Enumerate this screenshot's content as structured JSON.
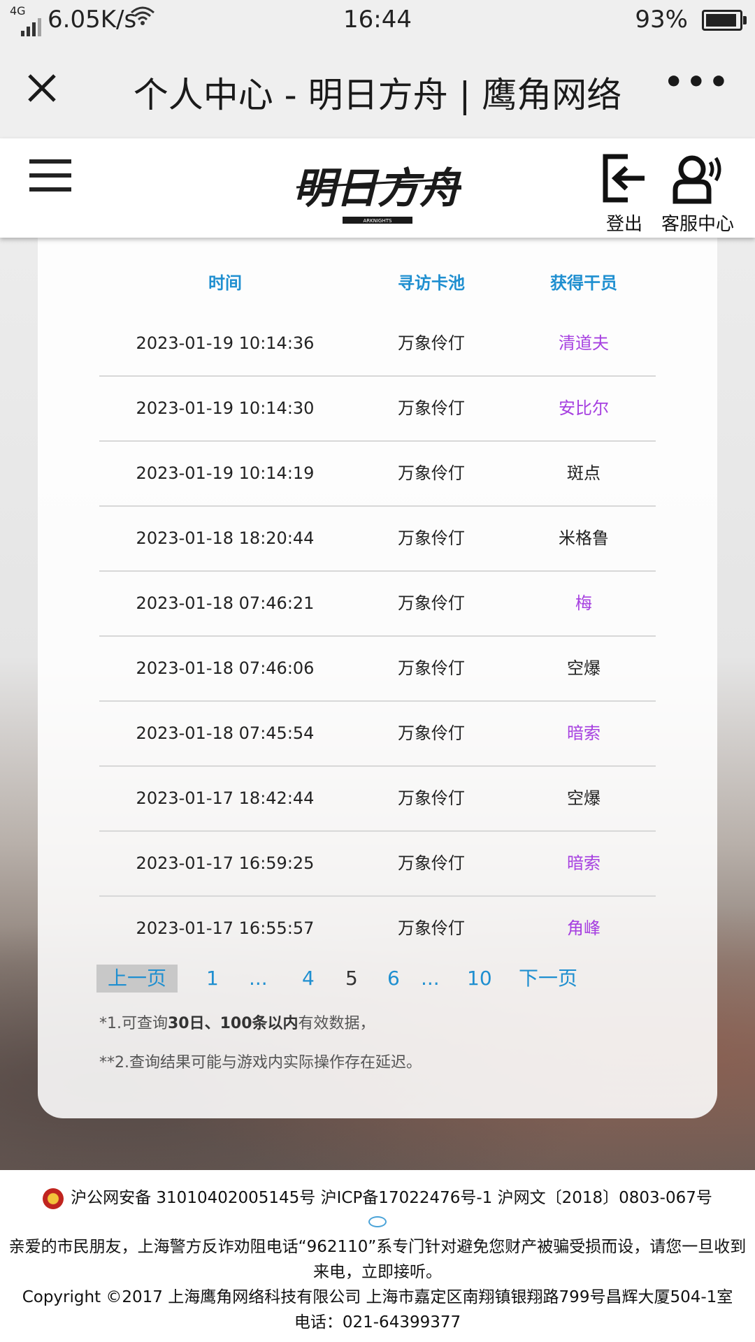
{
  "status_bar": {
    "network": "4G",
    "speed": "6.05K/s",
    "time": "16:44",
    "battery": "93%",
    "battery_level": 0.93
  },
  "title_bar": {
    "title": "个人中心 - 明日方舟 | 鹰角网络",
    "close_icon": "close-icon",
    "more_icon": "more-icon"
  },
  "site_header": {
    "menu_icon": "hamburger-icon",
    "logo_text": "明日方舟",
    "logo_sub": "ARKNIGHTS",
    "logout_label": "登出",
    "support_label": "客服中心"
  },
  "table": {
    "headers": [
      "时间",
      "寻访卡池",
      "获得干员"
    ],
    "rows": [
      {
        "time": "2023-01-19 10:14:36",
        "pool": "万象伶仃",
        "operator": "清道夫",
        "rare": true
      },
      {
        "time": "2023-01-19 10:14:30",
        "pool": "万象伶仃",
        "operator": "安比尔",
        "rare": true
      },
      {
        "time": "2023-01-19 10:14:19",
        "pool": "万象伶仃",
        "operator": "斑点",
        "rare": false
      },
      {
        "time": "2023-01-18 18:20:44",
        "pool": "万象伶仃",
        "operator": "米格鲁",
        "rare": false
      },
      {
        "time": "2023-01-18 07:46:21",
        "pool": "万象伶仃",
        "operator": "梅",
        "rare": true
      },
      {
        "time": "2023-01-18 07:46:06",
        "pool": "万象伶仃",
        "operator": "空爆",
        "rare": false
      },
      {
        "time": "2023-01-18 07:45:54",
        "pool": "万象伶仃",
        "operator": "暗索",
        "rare": true
      },
      {
        "time": "2023-01-17 18:42:44",
        "pool": "万象伶仃",
        "operator": "空爆",
        "rare": false
      },
      {
        "time": "2023-01-17 16:59:25",
        "pool": "万象伶仃",
        "operator": "暗索",
        "rare": true
      },
      {
        "time": "2023-01-17 16:55:57",
        "pool": "万象伶仃",
        "operator": "角峰",
        "rare": true
      }
    ]
  },
  "colors": {
    "header_blue": "#1f8fd0",
    "rare_purple": "#a640e0",
    "normal": "#222222"
  },
  "pagination": {
    "prev": "上一页",
    "pages": [
      "1",
      "...",
      "4",
      "5",
      "6",
      "...",
      "10"
    ],
    "current": "5",
    "next": "下一页"
  },
  "notes": {
    "n1_prefix": "*1.可查询",
    "n1_bold": "30日、100条以内",
    "n1_suffix": "有效数据，",
    "n2": "**2.查询结果可能与游戏内实际操作存在延迟。"
  },
  "footer": {
    "line1": "沪公网安备 31010402005145号  沪ICP备17022476号-1  沪网文〔2018〕0803-067号",
    "line2": "亲爱的市民朋友，上海警方反诈劝阻电话“962110”系专门针对避免您财产被骗受损而设，请您一旦收到来电，立即接听。",
    "line3": "Copyright ©2017 上海鹰角网络科技有限公司 上海市嘉定区南翔镇银翔路799号昌辉大厦504-1室",
    "line4": "电话：021-64399377"
  }
}
